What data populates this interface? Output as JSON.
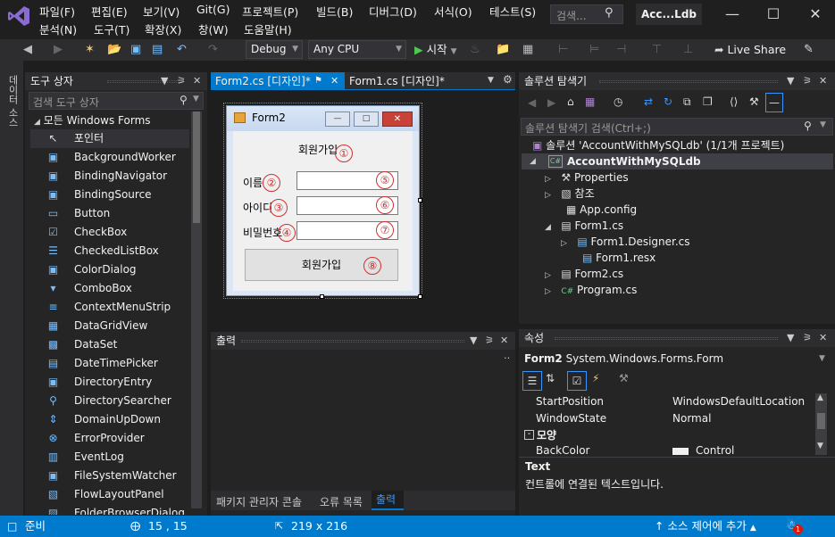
{
  "menu": {
    "row1": [
      "파일(F)",
      "편집(E)",
      "보기(V)",
      "Git(G)",
      "프로젝트(P)",
      "빌드(B)",
      "디버그(D)",
      "서식(O)",
      "테스트(S)"
    ],
    "row2": [
      "분석(N)",
      "도구(T)",
      "확장(X)",
      "창(W)",
      "도움말(H)"
    ]
  },
  "search": {
    "placeholder": "검색..."
  },
  "title": "Acc...Ldb",
  "toolbar": {
    "config": "Debug",
    "platform": "Any CPU",
    "start": "시작",
    "live_share": "Live Share"
  },
  "left_strip": {
    "label": "데이터 소스"
  },
  "toolbox": {
    "title": "도구 상자",
    "search_placeholder": "검색 도구 상자",
    "group": "모든 Windows Forms",
    "items": [
      {
        "label": "포인터",
        "icon": "pointer-icon"
      },
      {
        "label": "BackgroundWorker",
        "icon": "component-icon"
      },
      {
        "label": "BindingNavigator",
        "icon": "component-icon"
      },
      {
        "label": "BindingSource",
        "icon": "component-icon"
      },
      {
        "label": "Button",
        "icon": "button-icon"
      },
      {
        "label": "CheckBox",
        "icon": "checkbox-icon"
      },
      {
        "label": "CheckedListBox",
        "icon": "list-icon"
      },
      {
        "label": "ColorDialog",
        "icon": "component-icon"
      },
      {
        "label": "ComboBox",
        "icon": "combobox-icon"
      },
      {
        "label": "ContextMenuStrip",
        "icon": "menu-icon"
      },
      {
        "label": "DataGridView",
        "icon": "grid-icon"
      },
      {
        "label": "DataSet",
        "icon": "dataset-icon"
      },
      {
        "label": "DateTimePicker",
        "icon": "calendar-icon"
      },
      {
        "label": "DirectoryEntry",
        "icon": "component-icon"
      },
      {
        "label": "DirectorySearcher",
        "icon": "search-icon"
      },
      {
        "label": "DomainUpDown",
        "icon": "updown-icon"
      },
      {
        "label": "ErrorProvider",
        "icon": "error-icon"
      },
      {
        "label": "EventLog",
        "icon": "eventlog-icon"
      },
      {
        "label": "FileSystemWatcher",
        "icon": "component-icon"
      },
      {
        "label": "FlowLayoutPanel",
        "icon": "panel-icon"
      },
      {
        "label": "FolderBrowserDialog",
        "icon": "folder-icon"
      }
    ]
  },
  "tabs": {
    "active": "Form2.cs [디자인]*",
    "inactive": "Form1.cs [디자인]*"
  },
  "form": {
    "title": "Form2",
    "heading": "회원가입",
    "labels": [
      "이름",
      "아이디",
      "비밀번호"
    ],
    "button": "회원가입",
    "markers": [
      "①",
      "②",
      "③",
      "④",
      "⑤",
      "⑥",
      "⑦",
      "⑧"
    ]
  },
  "output": {
    "title": "출력",
    "tabs": [
      "패키지 관리자 콘솔",
      "오류 목록",
      "출력"
    ]
  },
  "solution": {
    "title": "솔루션 탐색기",
    "search_placeholder": "솔루션 탐색기 검색(Ctrl+;)",
    "solution_label": "솔루션 'AccountWithMySQLdb' (1/1개 프로젝트)",
    "project": "AccountWithMySQLdb",
    "nodes": [
      "Properties",
      "참조",
      "App.config",
      "Form1.cs",
      "Form1.Designer.cs",
      "Form1.resx",
      "Form2.cs",
      "Program.cs"
    ]
  },
  "properties": {
    "title": "속성",
    "object": "Form2",
    "object_type": "System.Windows.Forms.Form",
    "rows": [
      {
        "name": "StartPosition",
        "value": "WindowsDefaultLocation"
      },
      {
        "name": "WindowState",
        "value": "Normal"
      }
    ],
    "category": "모양",
    "partial_row": {
      "name": "BackColor",
      "value": "Control"
    },
    "desc_title": "Text",
    "desc_text": "컨트롤에 연결된 텍스트입니다."
  },
  "status": {
    "ready": "준비",
    "position": "15 , 15",
    "size": "219 x 216",
    "source_control": "소스 제어에 추가",
    "notifications": "1"
  },
  "colors": {
    "accent": "#007acc",
    "vs_purple": "#8661c5",
    "bg": "#1e1e1e"
  }
}
